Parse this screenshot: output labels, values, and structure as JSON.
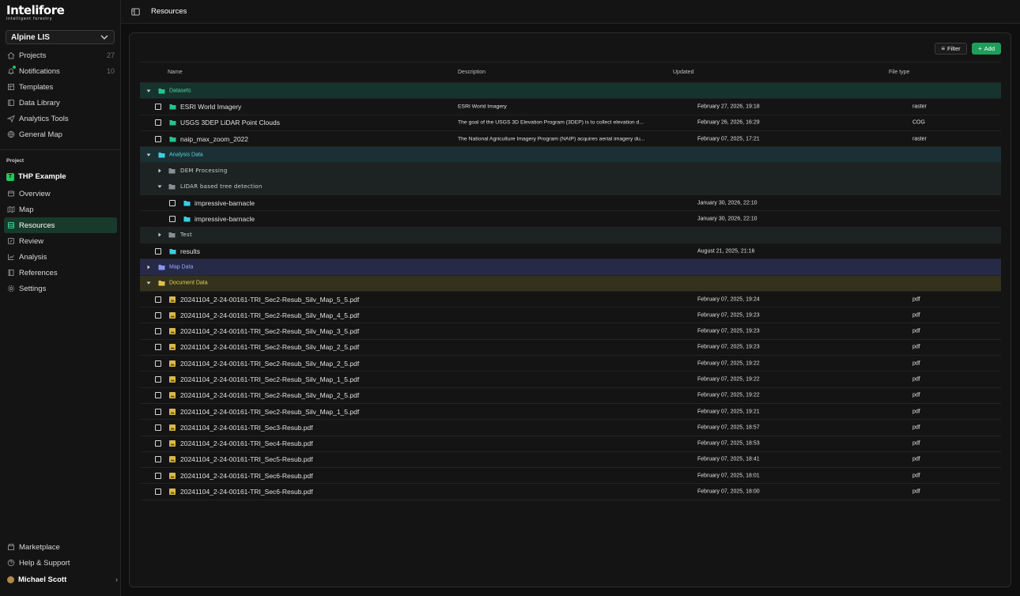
{
  "app": {
    "logo_wordmark": "Intelifore",
    "logo_tagline": "intelligent forestry",
    "org_select": "Alpine LIS"
  },
  "nav": {
    "items": [
      {
        "label": "Projects",
        "count": "27",
        "icon": "home-icon"
      },
      {
        "label": "Notifications",
        "count": "10",
        "icon": "bell-icon"
      },
      {
        "label": "Templates",
        "icon": "template-icon"
      },
      {
        "label": "Data Library",
        "icon": "library-icon"
      },
      {
        "label": "Analytics Tools",
        "icon": "send-icon"
      },
      {
        "label": "General Map",
        "icon": "globe-icon"
      }
    ]
  },
  "project": {
    "section_label": "Project",
    "badge": "T",
    "name": "THP Example",
    "items": [
      {
        "label": "Overview",
        "icon": "overview-icon"
      },
      {
        "label": "Map",
        "icon": "map-icon"
      },
      {
        "label": "Resources",
        "icon": "resources-icon",
        "active": true
      },
      {
        "label": "Review",
        "icon": "review-icon"
      },
      {
        "label": "Analysis",
        "icon": "chart-icon"
      },
      {
        "label": "References",
        "icon": "book-icon"
      },
      {
        "label": "Settings",
        "icon": "gear-icon"
      }
    ]
  },
  "footer": {
    "items": [
      {
        "label": "Marketplace",
        "icon": "store-icon"
      },
      {
        "label": "Help & Support",
        "icon": "help-icon"
      }
    ],
    "user_name": "Michael Scott"
  },
  "topbar": {
    "breadcrumb": "Resources"
  },
  "toolbar": {
    "filter_label": "Filter",
    "add_label": "Add"
  },
  "colors": {
    "accent_green": "#1f9d5a",
    "datasets_bg": "#16332d",
    "analysis_bg": "#1b3034",
    "map_bg": "#262a47",
    "document_bg": "#34321d"
  },
  "table": {
    "columns": [
      "Name",
      "Description",
      "Updated",
      "File type"
    ],
    "groups": {
      "datasets": "Datasets",
      "analysis": "Analysis Data",
      "map": "Map Data",
      "document": "Document Data"
    },
    "datasets": [
      {
        "name": "ESRI World Imagery",
        "description": "ESRI World Imagery",
        "updated": "February 27, 2026, 19:18",
        "type": "raster"
      },
      {
        "name": "USGS 3DEP LiDAR Point Clouds",
        "description": "The goal of the USGS 3D Elevation Program (3DEP) is to collect elevation d...",
        "updated": "February 26, 2026, 16:29",
        "type": "COG"
      },
      {
        "name": "naip_max_zoom_2022",
        "description": "The National Agriculture Imagery Program (NAIP) acquires aerial imagery du...",
        "updated": "February 07, 2025, 17:21",
        "type": "raster"
      }
    ],
    "analysis": {
      "subfolders": [
        "DEM Processing",
        "LIDAR based tree detection",
        "Test"
      ],
      "lidar_items": [
        {
          "name": "impressive-barnacle",
          "updated": "January 30, 2026, 22:10"
        },
        {
          "name": "impressive-barnacle",
          "updated": "January 30, 2026, 22:10"
        }
      ],
      "results": {
        "name": "results",
        "updated": "August 21, 2025, 21:16"
      }
    },
    "documents": [
      {
        "name": "20241104_2-24-00161-TRI_Sec2-Resub_Silv_Map_5_5.pdf",
        "updated": "February 07, 2025, 19:24",
        "type": "pdf"
      },
      {
        "name": "20241104_2-24-00161-TRI_Sec2-Resub_Silv_Map_4_5.pdf",
        "updated": "February 07, 2025, 19:23",
        "type": "pdf"
      },
      {
        "name": "20241104_2-24-00161-TRI_Sec2-Resub_Silv_Map_3_5.pdf",
        "updated": "February 07, 2025, 19:23",
        "type": "pdf"
      },
      {
        "name": "20241104_2-24-00161-TRI_Sec2-Resub_Silv_Map_2_5.pdf",
        "updated": "February 07, 2025, 19:23",
        "type": "pdf"
      },
      {
        "name": "20241104_2-24-00161-TRI_Sec2-Resub_Silv_Map_2_5.pdf",
        "updated": "February 07, 2025, 19:22",
        "type": "pdf"
      },
      {
        "name": "20241104_2-24-00161-TRI_Sec2-Resub_Silv_Map_1_5.pdf",
        "updated": "February 07, 2025, 19:22",
        "type": "pdf"
      },
      {
        "name": "20241104_2-24-00161-TRI_Sec2-Resub_Silv_Map_2_5.pdf",
        "updated": "February 07, 2025, 19:22",
        "type": "pdf"
      },
      {
        "name": "20241104_2-24-00161-TRI_Sec2-Resub_Silv_Map_1_5.pdf",
        "updated": "February 07, 2025, 19:21",
        "type": "pdf"
      },
      {
        "name": "20241104_2-24-00161-TRI_Sec3-Resub.pdf",
        "updated": "February 07, 2025, 18:57",
        "type": "pdf"
      },
      {
        "name": "20241104_2-24-00161-TRI_Sec4-Resub.pdf",
        "updated": "February 07, 2025, 18:53",
        "type": "pdf"
      },
      {
        "name": "20241104_2-24-00161-TRI_Sec5-Resub.pdf",
        "updated": "February 07, 2025, 18:41",
        "type": "pdf"
      },
      {
        "name": "20241104_2-24-00161-TRI_Sec6-Resub.pdf",
        "updated": "February 07, 2025, 18:01",
        "type": "pdf"
      },
      {
        "name": "20241104_2-24-00161-TRI_Sec6-Resub.pdf",
        "updated": "February 07, 2025, 18:00",
        "type": "pdf"
      }
    ]
  }
}
